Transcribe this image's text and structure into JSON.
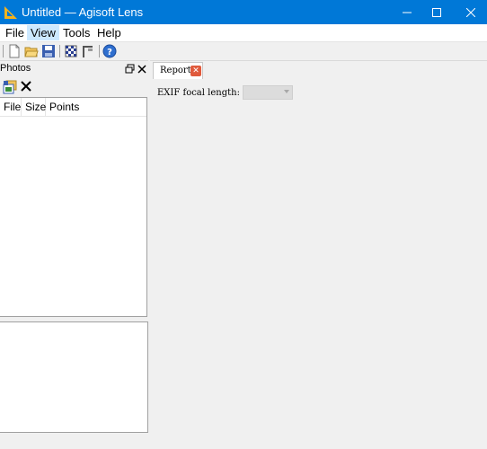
{
  "window": {
    "title": "Untitled — Agisoft Lens",
    "controls": [
      "minimize",
      "maximize",
      "close"
    ]
  },
  "menu": {
    "items": [
      {
        "label": "File"
      },
      {
        "label": "View",
        "active": true
      },
      {
        "label": "Tools"
      },
      {
        "label": "Help"
      }
    ]
  },
  "toolbar": {
    "buttons": [
      "new-icon",
      "open-icon",
      "save-icon",
      "checkerboard-icon",
      "calibration-icon",
      "help-icon"
    ]
  },
  "photos_panel": {
    "title": "Photos",
    "columns": [
      "File",
      "Size",
      "Points"
    ]
  },
  "report": {
    "tab_label": "Report",
    "exif_label": "EXIF focal length:",
    "exif_value": ""
  },
  "colors": {
    "titlebar": "#0078d7",
    "menu_active": "#cce8ff",
    "tab_close": "#e05a3c"
  }
}
